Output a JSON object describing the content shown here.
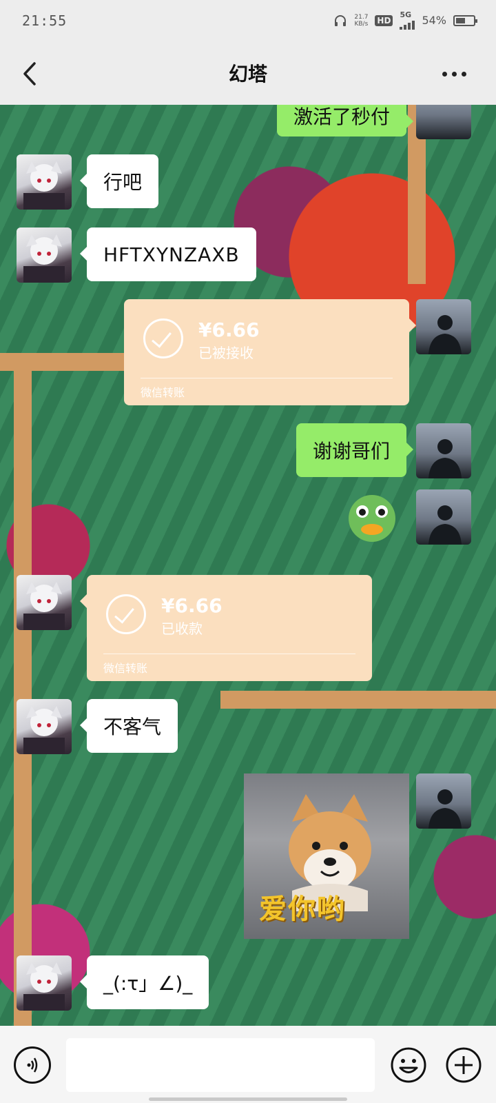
{
  "status_bar": {
    "time": "21:55",
    "net_speed": "21.7",
    "net_unit": "KB/s",
    "hd": "HD",
    "network": "5G",
    "battery": "54%",
    "battery_level": 0.54
  },
  "header": {
    "title": "幻塔"
  },
  "messages": [
    {
      "text": "激活了秒付",
      "side": "right",
      "type": "text"
    },
    {
      "text": "行吧",
      "side": "left",
      "type": "text"
    },
    {
      "text": "HFTXYNZAXB",
      "side": "left",
      "type": "text"
    },
    {
      "amount": "¥6.66",
      "status": "已被接收",
      "footer": "微信转账",
      "side": "right",
      "type": "transfer"
    },
    {
      "text": "谢谢哥们",
      "side": "right",
      "type": "text"
    },
    {
      "sticker": "duck-sticker",
      "side": "right",
      "type": "sticker"
    },
    {
      "amount": "¥6.66",
      "status": "已收款",
      "footer": "微信转账",
      "side": "left",
      "type": "transfer"
    },
    {
      "text": "不客气",
      "side": "left",
      "type": "text"
    },
    {
      "caption": "爱你哟",
      "side": "right",
      "type": "image"
    },
    {
      "text": "_(:τ」∠)_",
      "side": "left",
      "type": "text"
    }
  ],
  "input": {
    "value": "",
    "placeholder": ""
  },
  "icons": {
    "back": "chevron-left-icon",
    "more": "more-dots-icon",
    "voice": "voice-icon",
    "emoji": "emoji-icon",
    "plus": "plus-icon"
  },
  "colors": {
    "green_bubble": "#95ec69",
    "white_bubble": "#ffffff",
    "transfer": "#fbdfbf",
    "bar_bg": "#ededed"
  }
}
